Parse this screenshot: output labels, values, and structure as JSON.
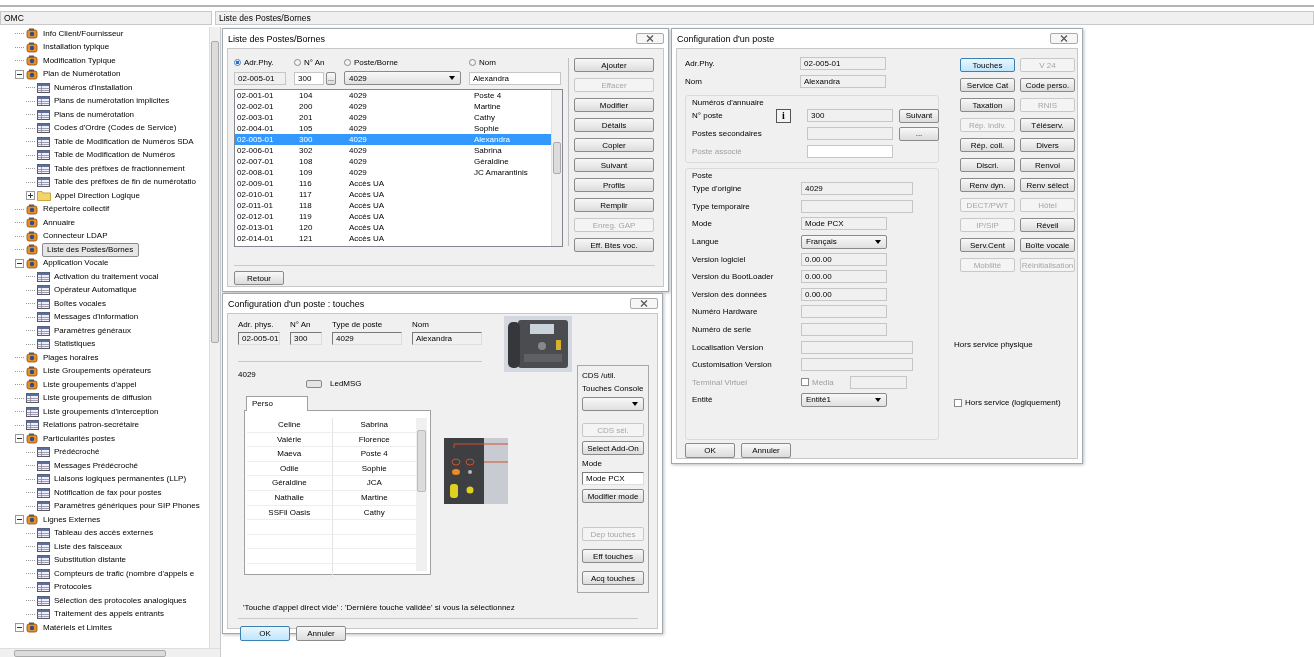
{
  "app": {
    "title": "OMC",
    "panel_title": "Liste des Postes/Bornes"
  },
  "tree": {
    "items": [
      {
        "label": "Info Client/Fournisseur",
        "kind": "module",
        "selected": false
      },
      {
        "label": "Installation typique",
        "kind": "module",
        "selected": false
      },
      {
        "label": "Modification Typique",
        "kind": "module",
        "selected": false
      },
      {
        "label": "Plan de Numérotation",
        "kind": "module",
        "selected": false,
        "expanded": true,
        "children": [
          {
            "label": "Numéros d'installation",
            "kind": "table",
            "selected": false
          },
          {
            "label": "Plans de numérotation implicites",
            "kind": "table",
            "selected": false
          },
          {
            "label": "Plans de numérotation",
            "kind": "table",
            "selected": false
          },
          {
            "label": "Codes d'Ordre (Codes de Service)",
            "kind": "table",
            "selected": false
          },
          {
            "label": "Table de Modification de Numéros SDA",
            "kind": "table",
            "selected": false
          },
          {
            "label": "Table de Modification de Numéros",
            "kind": "table",
            "selected": false
          },
          {
            "label": "Table des préfixes de fractionnement",
            "kind": "table",
            "selected": false
          },
          {
            "label": "Table des préfixes de fin de numérotatio",
            "kind": "table",
            "selected": false
          },
          {
            "label": "Appel Direction Logique",
            "kind": "folder",
            "selected": false,
            "expanded": false
          }
        ]
      },
      {
        "label": "Répertoire collectif",
        "kind": "module",
        "selected": false
      },
      {
        "label": "Annuaire",
        "kind": "module",
        "selected": false
      },
      {
        "label": "Connecteur LDAP",
        "kind": "module",
        "selected": false
      },
      {
        "label": "Liste des Postes/Bornes",
        "kind": "module",
        "selected": true
      },
      {
        "label": "Application Vocale",
        "kind": "module",
        "selected": false,
        "expanded": true,
        "children": [
          {
            "label": "Activation du traitement vocal",
            "kind": "table",
            "selected": false
          },
          {
            "label": "Opérateur Automatique",
            "kind": "table",
            "selected": false
          },
          {
            "label": "Boîtes vocales",
            "kind": "table",
            "selected": false
          },
          {
            "label": "Messages d'information",
            "kind": "table",
            "selected": false
          },
          {
            "label": "Paramètres généraux",
            "kind": "table",
            "selected": false
          },
          {
            "label": "Statistiques",
            "kind": "table",
            "selected": false
          }
        ]
      },
      {
        "label": "Plages horaires",
        "kind": "module",
        "selected": false
      },
      {
        "label": "Liste Groupements opérateurs",
        "kind": "module",
        "selected": false
      },
      {
        "label": "Liste groupements d'appel",
        "kind": "module",
        "selected": false
      },
      {
        "label": "Liste groupements de diffusion",
        "kind": "table",
        "selected": false
      },
      {
        "label": "Liste groupements d'interception",
        "kind": "table",
        "selected": false
      },
      {
        "label": "Relations patron-secrétaire",
        "kind": "table",
        "selected": false
      },
      {
        "label": "Particularités postes",
        "kind": "module",
        "selected": false,
        "expanded": true,
        "children": [
          {
            "label": "Prédécroché",
            "kind": "table",
            "selected": false
          },
          {
            "label": "Messages Prédécroché",
            "kind": "table",
            "selected": false
          },
          {
            "label": "Liaisons logiques permanentes (LLP)",
            "kind": "table",
            "selected": false
          },
          {
            "label": "Notification de fax pour postes",
            "kind": "table",
            "selected": false
          },
          {
            "label": "Paramètres génériques pour SIP Phones",
            "kind": "table",
            "selected": false
          }
        ]
      },
      {
        "label": "Lignes Externes",
        "kind": "module",
        "selected": false,
        "expanded": true,
        "children": [
          {
            "label": "Tableau des accès externes",
            "kind": "table",
            "selected": false
          },
          {
            "label": "Liste des faisceaux",
            "kind": "table",
            "selected": false
          },
          {
            "label": "Substitution distante",
            "kind": "table",
            "selected": false
          },
          {
            "label": "Compteurs de trafic (nombre d'appels e",
            "kind": "table",
            "selected": false
          },
          {
            "label": "Protocoles",
            "kind": "table",
            "selected": false
          },
          {
            "label": "Sélection des protocoles analogiques",
            "kind": "table",
            "selected": false
          },
          {
            "label": "Traitement des appels entrants",
            "kind": "table",
            "selected": false
          }
        ]
      },
      {
        "label": "Matériels et Limites",
        "kind": "module",
        "selected": false,
        "expanded": true
      }
    ]
  },
  "postes_list": {
    "title": "Liste des Postes/Bornes",
    "radios": [
      {
        "label": "Adr.Phy.",
        "selected": true
      },
      {
        "label": "N° An",
        "selected": false
      },
      {
        "label": "Poste/Borne",
        "selected": false
      },
      {
        "label": "Nom",
        "selected": false
      }
    ],
    "filters": {
      "adr": "02-005-01",
      "n_an": "300",
      "browse": "...",
      "poste": "4029",
      "nom": "Alexandra"
    },
    "rows": [
      {
        "adr": "02-001-01",
        "n_an": "104",
        "type": "4029",
        "nom": "Poste 4",
        "selected": false
      },
      {
        "adr": "02-002-01",
        "n_an": "200",
        "type": "4029",
        "nom": "Martine",
        "selected": false
      },
      {
        "adr": "02-003-01",
        "n_an": "201",
        "type": "4029",
        "nom": "Cathy",
        "selected": false
      },
      {
        "adr": "02-004-01",
        "n_an": "105",
        "type": "4029",
        "nom": "Sophie",
        "selected": false
      },
      {
        "adr": "02-005-01",
        "n_an": "300",
        "type": "4029",
        "nom": "Alexandra",
        "selected": true
      },
      {
        "adr": "02-006-01",
        "n_an": "302",
        "type": "4029",
        "nom": "Sabrina",
        "selected": false
      },
      {
        "adr": "02-007-01",
        "n_an": "108",
        "type": "4029",
        "nom": "Géraldine",
        "selected": false
      },
      {
        "adr": "02-008-01",
        "n_an": "109",
        "type": "4029",
        "nom": "JC Amarantinis",
        "selected": false
      },
      {
        "adr": "02-009-01",
        "n_an": "116",
        "type": "Accès UA",
        "selected": false
      },
      {
        "adr": "02-010-01",
        "n_an": "117",
        "type": "Accès UA",
        "selected": false
      },
      {
        "adr": "02-011-01",
        "n_an": "118",
        "type": "Accès UA",
        "selected": false
      },
      {
        "adr": "02-012-01",
        "n_an": "119",
        "type": "Accès UA",
        "selected": false
      },
      {
        "adr": "02-013-01",
        "n_an": "120",
        "type": "Accès UA",
        "selected": false
      },
      {
        "adr": "02-014-01",
        "n_an": "121",
        "type": "Accès UA",
        "selected": false
      }
    ],
    "buttons": [
      {
        "label": "Ajouter",
        "disabled": false
      },
      {
        "label": "Effacer",
        "disabled": true
      },
      {
        "label": "Modifier",
        "disabled": false
      },
      {
        "label": "Détails",
        "disabled": false
      },
      {
        "label": "Copier",
        "disabled": false
      },
      {
        "label": "Suivant",
        "disabled": false
      },
      {
        "label": "Profils",
        "disabled": false
      },
      {
        "label": "Remplir",
        "disabled": false
      },
      {
        "label": "Enreg. GAP",
        "disabled": true
      },
      {
        "label": "Eff. Btes voc.",
        "disabled": false
      }
    ],
    "back_button": "Retour"
  },
  "touches": {
    "title": "Configuration d'un poste : touches",
    "fields": [
      {
        "label": "Adr. phys.",
        "value": "02-005-01"
      },
      {
        "label": "N° An",
        "value": "300"
      },
      {
        "label": "Type de poste",
        "value": "4029"
      },
      {
        "label": "Nom",
        "value": "Alexandra"
      }
    ],
    "set_type": "4029",
    "led_label": "LedMSG",
    "tabs": [
      {
        "label": "Perso",
        "selected": true
      }
    ],
    "keys": [
      {
        "left": "Celine",
        "right": "Sabrina"
      },
      {
        "left": "Valérie",
        "right": "Florence"
      },
      {
        "left": "Maeva",
        "right": "Poste 4"
      },
      {
        "left": "Odile",
        "right": "Sophie"
      },
      {
        "left": "Géraldine",
        "right": "JCA"
      },
      {
        "left": "Nathalie",
        "right": "Martine"
      },
      {
        "left": "SSFil Oasis",
        "right": "Cathy"
      }
    ],
    "panel": {
      "title": "CDS /util.",
      "console_label": "Touches Console",
      "top_buttons": [
        {
          "label": "CDS sél.",
          "disabled": true
        },
        {
          "label": "Select Add-On",
          "disabled": false
        }
      ],
      "mode_label": "Mode",
      "mode_value": "Mode PCX",
      "mode_button": "Modifier mode",
      "bottom_buttons": [
        {
          "label": "Dep touches",
          "disabled": true
        },
        {
          "label": "Eff touches",
          "disabled": false
        },
        {
          "label": "Acq touches",
          "disabled": false
        }
      ]
    },
    "note": "'Touche d'appel direct vide' : 'Dernière touche validée' si vous la sélectionnez",
    "buttons": [
      {
        "label": "OK",
        "default": true
      },
      {
        "label": "Annuler",
        "default": false
      }
    ]
  },
  "config": {
    "title": "Configuration d'un poste",
    "top": [
      {
        "label": "Adr.Phy.",
        "value": "02-005-01"
      },
      {
        "label": "Nom",
        "value": "Alexandra"
      }
    ],
    "directory": {
      "title": "Numéros d'annuaire",
      "rows": [
        {
          "label": "N° poste",
          "info": "i",
          "value": "300",
          "button": "Suivant",
          "disabled": false
        },
        {
          "label": "Postes secondaires",
          "button": "...",
          "disabled": false
        },
        {
          "label": "Poste associé",
          "disabled": true
        }
      ]
    },
    "station": {
      "title": "Poste",
      "rows": [
        {
          "kind": "wide",
          "label": "Type d'origine",
          "value": "4029",
          "disabled": false
        },
        {
          "kind": "wide",
          "label": "Type temporaire",
          "disabled": false
        },
        {
          "kind": "field",
          "label": "Mode",
          "value": "Mode PCX",
          "disabled": false
        },
        {
          "kind": "select",
          "label": "Langue",
          "value": "Français",
          "disabled": false
        },
        {
          "kind": "field",
          "label": "Version logiciel",
          "value": "0.00.00",
          "disabled": false
        },
        {
          "kind": "field",
          "label": "Version du BootLoader",
          "value": "0.00.00",
          "disabled": false
        },
        {
          "kind": "field",
          "label": "Version des données",
          "value": "0.00.00",
          "disabled": false
        },
        {
          "kind": "field",
          "label": "Numéro Hardware",
          "disabled": false
        },
        {
          "kind": "field",
          "label": "Numéro de serie",
          "disabled": false
        },
        {
          "kind": "wide",
          "label": "Localisation Version",
          "disabled": false
        },
        {
          "kind": "wide",
          "label": "Customisation Version",
          "disabled": false
        },
        {
          "kind": "virtual",
          "label": "Terminal Virtuel",
          "disabled": true,
          "checkbox": {
            "label": "Media",
            "checked": false
          }
        },
        {
          "kind": "select",
          "label": "Entité",
          "value": "Entité1",
          "disabled": false
        }
      ]
    },
    "actions": [
      {
        "label": "Touches",
        "disabled": false,
        "default": true
      },
      {
        "label": "V 24",
        "disabled": true,
        "default": false
      },
      {
        "label": "Service Cat",
        "disabled": false,
        "default": false
      },
      {
        "label": "Code perso.",
        "disabled": false,
        "default": false
      },
      {
        "label": "Taxation",
        "disabled": false,
        "default": false
      },
      {
        "label": "RNIS",
        "disabled": true,
        "default": false
      },
      {
        "label": "Rép. indiv.",
        "disabled": true,
        "default": false
      },
      {
        "label": "Téléserv.",
        "disabled": false,
        "default": false
      },
      {
        "label": "Rép. coll.",
        "disabled": false,
        "default": false
      },
      {
        "label": "Divers",
        "disabled": false,
        "default": false
      },
      {
        "label": "Discri.",
        "disabled": false,
        "default": false
      },
      {
        "label": "Renvoi",
        "disabled": false,
        "default": false
      },
      {
        "label": "Renv dyn.",
        "disabled": false,
        "default": false
      },
      {
        "label": "Renv sélect",
        "disabled": false,
        "default": false
      },
      {
        "label": "DECT/PWT",
        "disabled": true,
        "default": false
      },
      {
        "label": "Hôtel",
        "disabled": true,
        "default": false
      },
      {
        "label": "IP/SIP",
        "disabled": true,
        "default": false
      },
      {
        "label": "Réveil",
        "disabled": false,
        "default": false
      },
      {
        "label": "Serv.Cent",
        "disabled": false,
        "default": false
      },
      {
        "label": "Boîte vocale",
        "disabled": false,
        "default": false
      },
      {
        "label": "Mobilité",
        "disabled": true,
        "default": false
      },
      {
        "label": "Réinitialisation",
        "disabled": true,
        "default": false
      }
    ],
    "physical_out": "Hors service physique",
    "logical_out": {
      "label": "Hors service (logiquement)",
      "checked": false
    },
    "buttons": [
      {
        "label": "OK",
        "default": false
      },
      {
        "label": "Annuler",
        "default": false
      }
    ]
  }
}
